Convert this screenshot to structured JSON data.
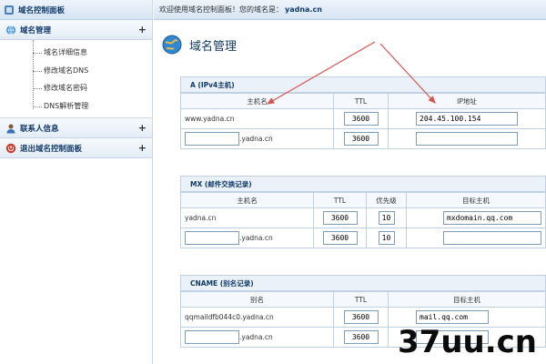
{
  "sidebar": {
    "title": "域名控制面板",
    "groups": [
      {
        "label": "域名管理",
        "toggle": "+",
        "items": [
          "域名详细信息",
          "修改域名DNS",
          "修改域名密码",
          "DNS解析管理"
        ]
      },
      {
        "label": "联系人信息",
        "toggle": "+"
      },
      {
        "label": "退出域名控制面板",
        "toggle": "+"
      }
    ]
  },
  "topbar": {
    "welcome": "欢迎使用域名控制面板！您的域名是：",
    "domain": "yadna.cn"
  },
  "page": {
    "title": "域名管理"
  },
  "sections": {
    "a": {
      "title": "A (IPv4主机)",
      "headers": [
        "主机名",
        "TTL",
        "IP地址"
      ],
      "rows": [
        {
          "host": "www.yadna.cn",
          "ttl": "3600",
          "ip": "204.45.100.154"
        },
        {
          "host_input": "",
          "suffix": ".yadna.cn",
          "ttl": "3600",
          "ip": ""
        }
      ]
    },
    "mx": {
      "title": "MX (邮件交换记录)",
      "headers": [
        "主机名",
        "TTL",
        "优先级",
        "目标主机"
      ],
      "rows": [
        {
          "host": "yadna.cn",
          "ttl": "3600",
          "priority": "10",
          "target": "mxdomain.qq.com"
        },
        {
          "host_input": "",
          "suffix": ".yadna.cn",
          "ttl": "3600",
          "priority": "10",
          "target": ""
        }
      ]
    },
    "cname": {
      "title": "CNAME (别名记录)",
      "headers": [
        "别名",
        "TTL",
        "目标主机"
      ],
      "rows": [
        {
          "host": "qqmaildfb044c0.yadna.cn",
          "ttl": "3600",
          "target": "mail.qq.com"
        },
        {
          "host_input": "",
          "suffix": ".yadna.cn",
          "ttl": "3600",
          "target": ""
        }
      ]
    }
  },
  "watermark": "37uu.cn",
  "colors": {
    "arrow": "#d9534f",
    "header_text": "#123a6a",
    "border": "#c0d1e4"
  }
}
